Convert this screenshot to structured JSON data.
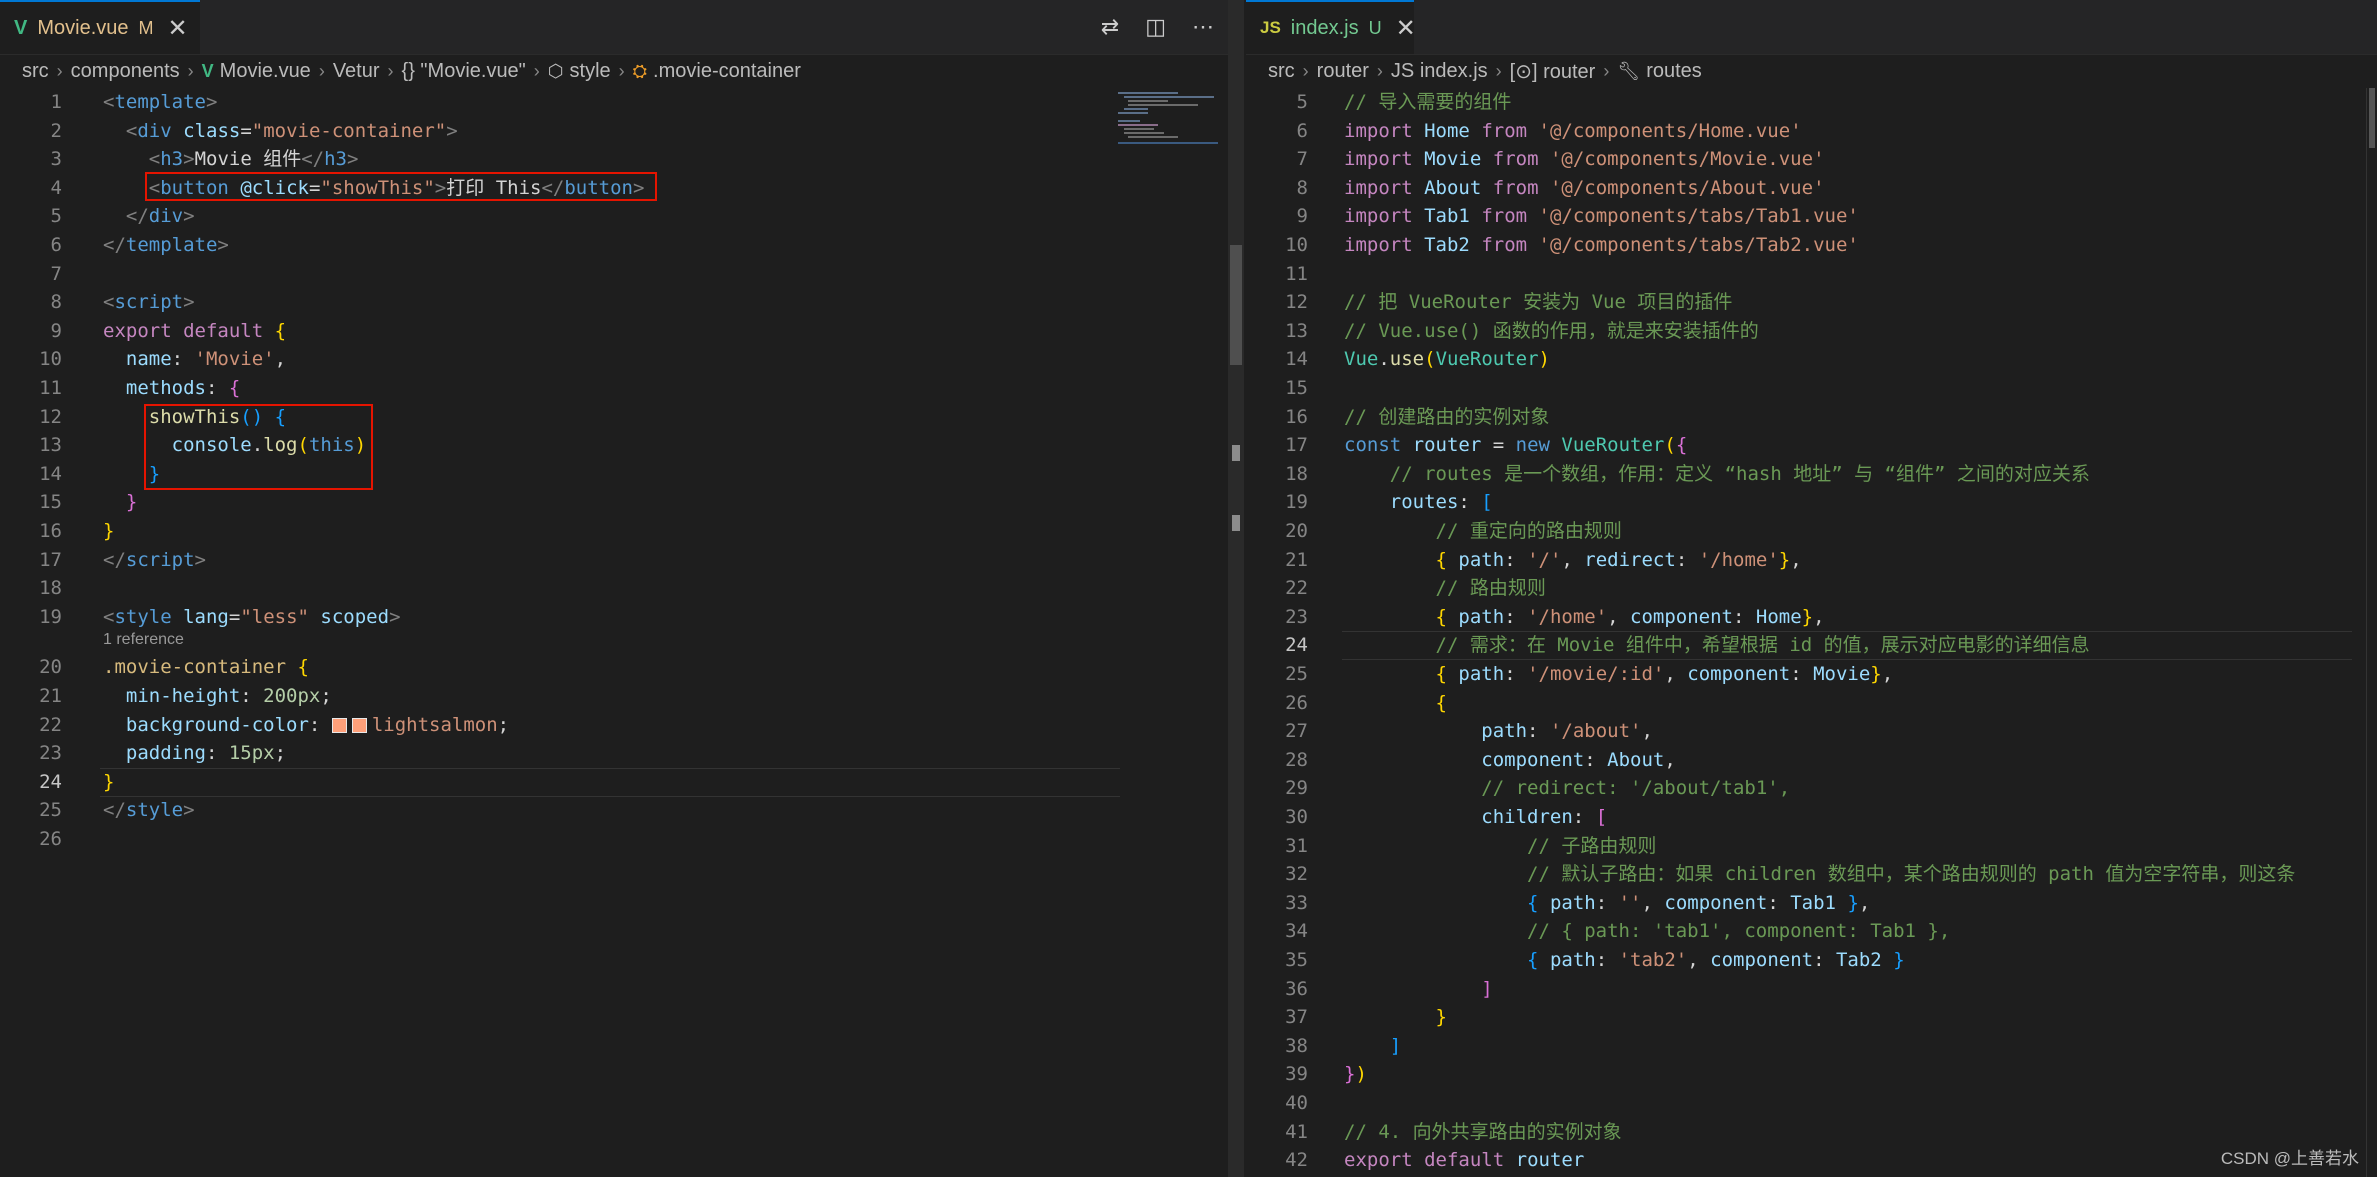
{
  "left_editor": {
    "tab": {
      "icon": "V",
      "name": "Movie.vue",
      "status": "M",
      "close": "✕"
    },
    "actions": [
      "⇄",
      "◫",
      "⋯"
    ],
    "breadcrumb": [
      "src",
      "components",
      "Movie.vue",
      "Vetur",
      "{} \"Movie.vue\"",
      "style",
      ".movie-container"
    ],
    "codelens": "1 reference",
    "line_numbers": [
      "1",
      "2",
      "3",
      "4",
      "5",
      "6",
      "7",
      "8",
      "9",
      "10",
      "11",
      "12",
      "13",
      "14",
      "15",
      "16",
      "17",
      "18",
      "19",
      "20",
      "21",
      "22",
      "23",
      "24",
      "25",
      "26"
    ],
    "current_line": "24",
    "lines": [
      [
        [
          "t-ang",
          "<"
        ],
        [
          "t-tag",
          "template"
        ],
        [
          "t-ang",
          ">"
        ]
      ],
      [
        [
          "t-txt",
          "  "
        ],
        [
          "t-ang",
          "<"
        ],
        [
          "t-tag",
          "div"
        ],
        [
          "t-txt",
          " "
        ],
        [
          "t-attr",
          "class"
        ],
        [
          "t-txt",
          "="
        ],
        [
          "t-str",
          "\"movie-container\""
        ],
        [
          "t-ang",
          ">"
        ]
      ],
      [
        [
          "t-txt",
          "    "
        ],
        [
          "t-ang",
          "<"
        ],
        [
          "t-tag",
          "h3"
        ],
        [
          "t-ang",
          ">"
        ],
        [
          "t-txt",
          "Movie 组件"
        ],
        [
          "t-ang",
          "</"
        ],
        [
          "t-tag",
          "h3"
        ],
        [
          "t-ang",
          ">"
        ]
      ],
      [
        [
          "t-txt",
          "    "
        ],
        [
          "t-ang",
          "<"
        ],
        [
          "t-tag",
          "button"
        ],
        [
          "t-txt",
          " "
        ],
        [
          "t-attr",
          "@click"
        ],
        [
          "t-txt",
          "="
        ],
        [
          "t-str",
          "\"showThis\""
        ],
        [
          "t-ang",
          ">"
        ],
        [
          "t-txt",
          "打印 This"
        ],
        [
          "t-ang",
          "</"
        ],
        [
          "t-tag",
          "button"
        ],
        [
          "t-ang",
          ">"
        ]
      ],
      [
        [
          "t-txt",
          "  "
        ],
        [
          "t-ang",
          "</"
        ],
        [
          "t-tag",
          "div"
        ],
        [
          "t-ang",
          ">"
        ]
      ],
      [
        [
          "t-ang",
          "</"
        ],
        [
          "t-tag",
          "template"
        ],
        [
          "t-ang",
          ">"
        ]
      ],
      [],
      [
        [
          "t-ang",
          "<"
        ],
        [
          "t-tag",
          "script"
        ],
        [
          "t-ang",
          ">"
        ]
      ],
      [
        [
          "t-kw",
          "export"
        ],
        [
          "t-txt",
          " "
        ],
        [
          "t-kw",
          "default"
        ],
        [
          "t-txt",
          " "
        ],
        [
          "t-b1",
          "{"
        ]
      ],
      [
        [
          "t-txt",
          "  "
        ],
        [
          "t-var",
          "name"
        ],
        [
          "t-txt",
          ": "
        ],
        [
          "t-str",
          "'Movie'"
        ],
        [
          "t-txt",
          ","
        ]
      ],
      [
        [
          "t-txt",
          "  "
        ],
        [
          "t-var",
          "methods"
        ],
        [
          "t-txt",
          ": "
        ],
        [
          "t-b2",
          "{"
        ]
      ],
      [
        [
          "t-txt",
          "    "
        ],
        [
          "t-fn",
          "showThis"
        ],
        [
          "t-b3",
          "()"
        ],
        [
          "t-txt",
          " "
        ],
        [
          "t-b3",
          "{"
        ]
      ],
      [
        [
          "t-txt",
          "      "
        ],
        [
          "t-var",
          "console"
        ],
        [
          "t-txt",
          "."
        ],
        [
          "t-fn",
          "log"
        ],
        [
          "t-b1",
          "("
        ],
        [
          "t-kw2",
          "this"
        ],
        [
          "t-b1",
          ")"
        ]
      ],
      [
        [
          "t-txt",
          "    "
        ],
        [
          "t-b3",
          "}"
        ]
      ],
      [
        [
          "t-txt",
          "  "
        ],
        [
          "t-b2",
          "}"
        ]
      ],
      [
        [
          "t-b1",
          "}"
        ]
      ],
      [
        [
          "t-ang",
          "</"
        ],
        [
          "t-tag",
          "script"
        ],
        [
          "t-ang",
          ">"
        ]
      ],
      [],
      [
        [
          "t-ang",
          "<"
        ],
        [
          "t-tag",
          "style"
        ],
        [
          "t-txt",
          " "
        ],
        [
          "t-attr",
          "lang"
        ],
        [
          "t-txt",
          "="
        ],
        [
          "t-str",
          "\"less\""
        ],
        [
          "t-txt",
          " "
        ],
        [
          "t-attr",
          "scoped"
        ],
        [
          "t-ang",
          ">"
        ]
      ],
      [
        [
          "t-sel",
          ".movie-container"
        ],
        [
          "t-txt",
          " "
        ],
        [
          "t-b1",
          "{"
        ]
      ],
      [
        [
          "t-txt",
          "  "
        ],
        [
          "t-attr",
          "min-height"
        ],
        [
          "t-txt",
          ": "
        ],
        [
          "t-num",
          "200px"
        ],
        [
          "t-txt",
          ";"
        ]
      ],
      [
        [
          "t-txt",
          "  "
        ],
        [
          "t-attr",
          "background-color"
        ],
        [
          "t-txt",
          ": "
        ],
        [
          "swatch",
          ""
        ],
        [
          "swatch",
          ""
        ],
        [
          "t-val",
          "lightsalmon"
        ],
        [
          "t-txt",
          ";"
        ]
      ],
      [
        [
          "t-txt",
          "  "
        ],
        [
          "t-attr",
          "padding"
        ],
        [
          "t-txt",
          ": "
        ],
        [
          "t-num",
          "15px"
        ],
        [
          "t-txt",
          ";"
        ]
      ],
      [
        [
          "t-b1",
          "}"
        ]
      ],
      [
        [
          "t-ang",
          "</"
        ],
        [
          "t-tag",
          "style"
        ],
        [
          "t-ang",
          ">"
        ]
      ],
      []
    ]
  },
  "right_editor": {
    "tab": {
      "icon": "JS",
      "name": "index.js",
      "status": "U",
      "close": "✕"
    },
    "breadcrumb": [
      "src",
      "router",
      "JS index.js",
      "[⊙] router",
      "routes"
    ],
    "line_numbers": [
      "5",
      "6",
      "7",
      "8",
      "9",
      "10",
      "11",
      "12",
      "13",
      "14",
      "15",
      "16",
      "17",
      "18",
      "19",
      "20",
      "21",
      "22",
      "23",
      "24",
      "25",
      "26",
      "27",
      "28",
      "29",
      "30",
      "31",
      "32",
      "33",
      "34",
      "35",
      "36",
      "37",
      "38",
      "39",
      "40",
      "41",
      "42"
    ],
    "current_line": "24",
    "lines": [
      [
        [
          "t-cmt",
          "// 导入需要的组件"
        ]
      ],
      [
        [
          "t-kw",
          "import"
        ],
        [
          "t-txt",
          " "
        ],
        [
          "t-var",
          "Home"
        ],
        [
          "t-txt",
          " "
        ],
        [
          "t-kw",
          "from"
        ],
        [
          "t-txt",
          " "
        ],
        [
          "t-str",
          "'@/components/Home.vue'"
        ]
      ],
      [
        [
          "t-kw",
          "import"
        ],
        [
          "t-txt",
          " "
        ],
        [
          "t-var",
          "Movie"
        ],
        [
          "t-txt",
          " "
        ],
        [
          "t-kw",
          "from"
        ],
        [
          "t-txt",
          " "
        ],
        [
          "t-str",
          "'@/components/Movie.vue'"
        ]
      ],
      [
        [
          "t-kw",
          "import"
        ],
        [
          "t-txt",
          " "
        ],
        [
          "t-var",
          "About"
        ],
        [
          "t-txt",
          " "
        ],
        [
          "t-kw",
          "from"
        ],
        [
          "t-txt",
          " "
        ],
        [
          "t-str",
          "'@/components/About.vue'"
        ]
      ],
      [
        [
          "t-kw",
          "import"
        ],
        [
          "t-txt",
          " "
        ],
        [
          "t-var",
          "Tab1"
        ],
        [
          "t-txt",
          " "
        ],
        [
          "t-kw",
          "from"
        ],
        [
          "t-txt",
          " "
        ],
        [
          "t-str",
          "'@/components/tabs/Tab1.vue'"
        ]
      ],
      [
        [
          "t-kw",
          "import"
        ],
        [
          "t-txt",
          " "
        ],
        [
          "t-var",
          "Tab2"
        ],
        [
          "t-txt",
          " "
        ],
        [
          "t-kw",
          "from"
        ],
        [
          "t-txt",
          " "
        ],
        [
          "t-str",
          "'@/components/tabs/Tab2.vue'"
        ]
      ],
      [],
      [
        [
          "t-cmt",
          "// 把 VueRouter 安装为 Vue 项目的插件"
        ]
      ],
      [
        [
          "t-cmt",
          "// Vue.use() 函数的作用，就是来安装插件的"
        ]
      ],
      [
        [
          "t-cls",
          "Vue"
        ],
        [
          "t-txt",
          "."
        ],
        [
          "t-fn",
          "use"
        ],
        [
          "t-b1",
          "("
        ],
        [
          "t-cls",
          "VueRouter"
        ],
        [
          "t-b1",
          ")"
        ]
      ],
      [],
      [
        [
          "t-cmt",
          "// 创建路由的实例对象"
        ]
      ],
      [
        [
          "t-kw2",
          "const"
        ],
        [
          "t-txt",
          " "
        ],
        [
          "t-var",
          "router"
        ],
        [
          "t-txt",
          " = "
        ],
        [
          "t-kw2",
          "new"
        ],
        [
          "t-txt",
          " "
        ],
        [
          "t-cls",
          "VueRouter"
        ],
        [
          "t-b1",
          "("
        ],
        [
          "t-b2",
          "{"
        ]
      ],
      [
        [
          "t-txt",
          "    "
        ],
        [
          "t-cmt",
          "// routes 是一个数组，作用：定义 “hash 地址” 与 “组件” 之间的对应关系"
        ]
      ],
      [
        [
          "t-txt",
          "    "
        ],
        [
          "t-var",
          "routes"
        ],
        [
          "t-txt",
          ": "
        ],
        [
          "t-b3",
          "["
        ]
      ],
      [
        [
          "t-txt",
          "        "
        ],
        [
          "t-cmt",
          "// 重定向的路由规则"
        ]
      ],
      [
        [
          "t-txt",
          "        "
        ],
        [
          "t-b1",
          "{"
        ],
        [
          "t-txt",
          " "
        ],
        [
          "t-var",
          "path"
        ],
        [
          "t-txt",
          ": "
        ],
        [
          "t-str",
          "'/'"
        ],
        [
          "t-txt",
          ", "
        ],
        [
          "t-var",
          "redirect"
        ],
        [
          "t-txt",
          ": "
        ],
        [
          "t-str",
          "'/home'"
        ],
        [
          "t-b1",
          "}"
        ],
        [
          "t-txt",
          ","
        ]
      ],
      [
        [
          "t-txt",
          "        "
        ],
        [
          "t-cmt",
          "// 路由规则"
        ]
      ],
      [
        [
          "t-txt",
          "        "
        ],
        [
          "t-b1",
          "{"
        ],
        [
          "t-txt",
          " "
        ],
        [
          "t-var",
          "path"
        ],
        [
          "t-txt",
          ": "
        ],
        [
          "t-str",
          "'/home'"
        ],
        [
          "t-txt",
          ", "
        ],
        [
          "t-var",
          "component"
        ],
        [
          "t-txt",
          ": "
        ],
        [
          "t-var",
          "Home"
        ],
        [
          "t-b1",
          "}"
        ],
        [
          "t-txt",
          ","
        ]
      ],
      [
        [
          "t-txt",
          "        "
        ],
        [
          "t-cmt",
          "// 需求：在 Movie 组件中，希望根据 id 的值，展示对应电影的详细信息"
        ]
      ],
      [
        [
          "t-txt",
          "        "
        ],
        [
          "t-b1",
          "{"
        ],
        [
          "t-txt",
          " "
        ],
        [
          "t-var",
          "path"
        ],
        [
          "t-txt",
          ": "
        ],
        [
          "t-str",
          "'/movie/:id'"
        ],
        [
          "t-txt",
          ", "
        ],
        [
          "t-var",
          "component"
        ],
        [
          "t-txt",
          ": "
        ],
        [
          "t-var",
          "Movie"
        ],
        [
          "t-b1",
          "}"
        ],
        [
          "t-txt",
          ","
        ]
      ],
      [
        [
          "t-txt",
          "        "
        ],
        [
          "t-b1",
          "{"
        ]
      ],
      [
        [
          "t-txt",
          "            "
        ],
        [
          "t-var",
          "path"
        ],
        [
          "t-txt",
          ": "
        ],
        [
          "t-str",
          "'/about'"
        ],
        [
          "t-txt",
          ","
        ]
      ],
      [
        [
          "t-txt",
          "            "
        ],
        [
          "t-var",
          "component"
        ],
        [
          "t-txt",
          ": "
        ],
        [
          "t-var",
          "About"
        ],
        [
          "t-txt",
          ","
        ]
      ],
      [
        [
          "t-txt",
          "            "
        ],
        [
          "t-cmt",
          "// redirect: '/about/tab1',"
        ]
      ],
      [
        [
          "t-txt",
          "            "
        ],
        [
          "t-var",
          "children"
        ],
        [
          "t-txt",
          ": "
        ],
        [
          "t-b2",
          "["
        ]
      ],
      [
        [
          "t-txt",
          "                "
        ],
        [
          "t-cmt",
          "// 子路由规则"
        ]
      ],
      [
        [
          "t-txt",
          "                "
        ],
        [
          "t-cmt",
          "// 默认子路由：如果 children 数组中，某个路由规则的 path 值为空字符串，则这条"
        ]
      ],
      [
        [
          "t-txt",
          "                "
        ],
        [
          "t-b3",
          "{"
        ],
        [
          "t-txt",
          " "
        ],
        [
          "t-var",
          "path"
        ],
        [
          "t-txt",
          ": "
        ],
        [
          "t-str",
          "''"
        ],
        [
          "t-txt",
          ", "
        ],
        [
          "t-var",
          "component"
        ],
        [
          "t-txt",
          ": "
        ],
        [
          "t-var",
          "Tab1"
        ],
        [
          "t-txt",
          " "
        ],
        [
          "t-b3",
          "}"
        ],
        [
          "t-txt",
          ","
        ]
      ],
      [
        [
          "t-txt",
          "                "
        ],
        [
          "t-cmt",
          "// { path: 'tab1', component: Tab1 },"
        ]
      ],
      [
        [
          "t-txt",
          "                "
        ],
        [
          "t-b3",
          "{"
        ],
        [
          "t-txt",
          " "
        ],
        [
          "t-var",
          "path"
        ],
        [
          "t-txt",
          ": "
        ],
        [
          "t-str",
          "'tab2'"
        ],
        [
          "t-txt",
          ", "
        ],
        [
          "t-var",
          "component"
        ],
        [
          "t-txt",
          ": "
        ],
        [
          "t-var",
          "Tab2"
        ],
        [
          "t-txt",
          " "
        ],
        [
          "t-b3",
          "}"
        ]
      ],
      [
        [
          "t-txt",
          "            "
        ],
        [
          "t-b2",
          "]"
        ]
      ],
      [
        [
          "t-txt",
          "        "
        ],
        [
          "t-b1",
          "}"
        ]
      ],
      [
        [
          "t-txt",
          "    "
        ],
        [
          "t-b3",
          "]"
        ]
      ],
      [
        [
          "t-b2",
          "}"
        ],
        [
          "t-b1",
          ")"
        ]
      ],
      [],
      [
        [
          "t-cmt",
          "// 4. 向外共享路由的实例对象"
        ]
      ],
      [
        [
          "t-kw",
          "export"
        ],
        [
          "t-txt",
          " "
        ],
        [
          "t-kw",
          "default"
        ],
        [
          "t-txt",
          " "
        ],
        [
          "t-var",
          "router"
        ]
      ]
    ]
  },
  "watermark": "CSDN @上善若水",
  "colors": {
    "accent": "#0078d4",
    "highlight_box": "#e51400",
    "lightsalmon": "#ffa07a"
  }
}
